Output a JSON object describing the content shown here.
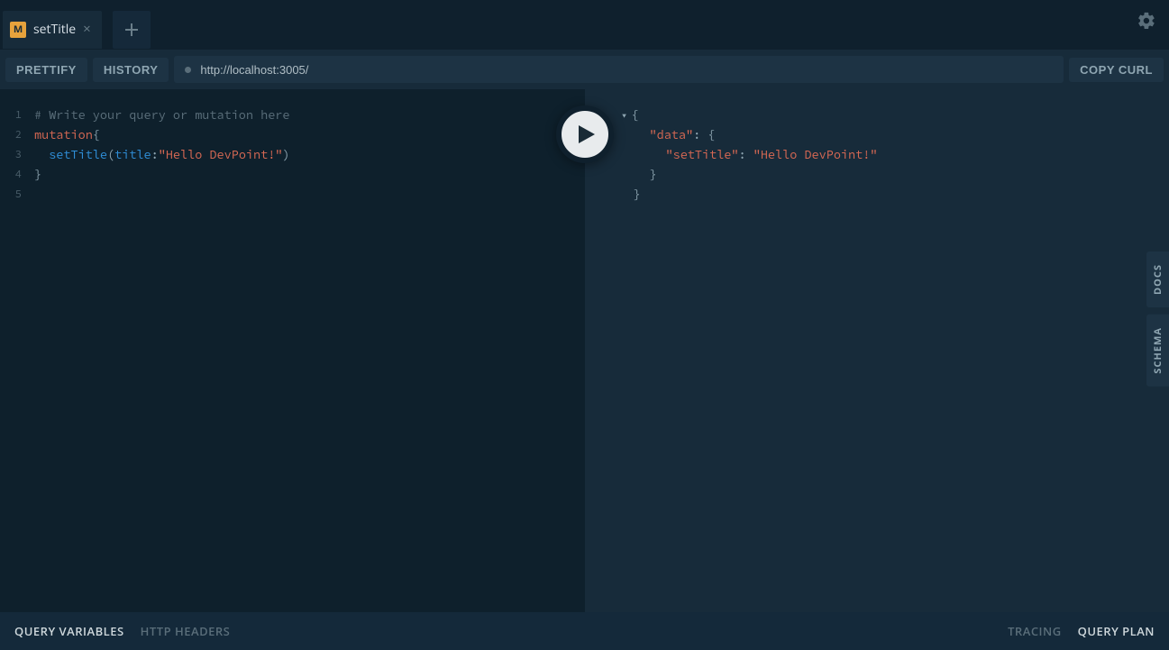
{
  "tab": {
    "op_badge": "M",
    "label": "setTitle"
  },
  "toolbar": {
    "prettify": "PRETTIFY",
    "history": "HISTORY",
    "endpoint": "http://localhost:3005/",
    "copy_curl": "COPY CURL"
  },
  "editor": {
    "lines": [
      "1",
      "2",
      "3",
      "4",
      "5"
    ],
    "line1_comment": "# Write your query or mutation here",
    "line2_keyword": "mutation",
    "line2_brace": "{",
    "line3_indent": "  ",
    "line3_field": "setTitle",
    "line3_lparen": "(",
    "line3_arg": "title",
    "line3_colon": ":",
    "line3_string": "\"Hello DevPoint!\"",
    "line3_rparen": ")",
    "line4_brace": "}"
  },
  "response": {
    "caret": "▾",
    "open_brace": "{",
    "data_key": "\"data\"",
    "colon": ":",
    "data_open": "{",
    "title_key": "\"setTitle\"",
    "title_val": "\"Hello DevPoint!\"",
    "data_close": "}",
    "close_brace": "}"
  },
  "side": {
    "docs": "DOCS",
    "schema": "SCHEMA"
  },
  "footer": {
    "qv": "QUERY VARIABLES",
    "hh": "HTTP HEADERS",
    "tracing": "TRACING",
    "qp": "QUERY PLAN"
  }
}
